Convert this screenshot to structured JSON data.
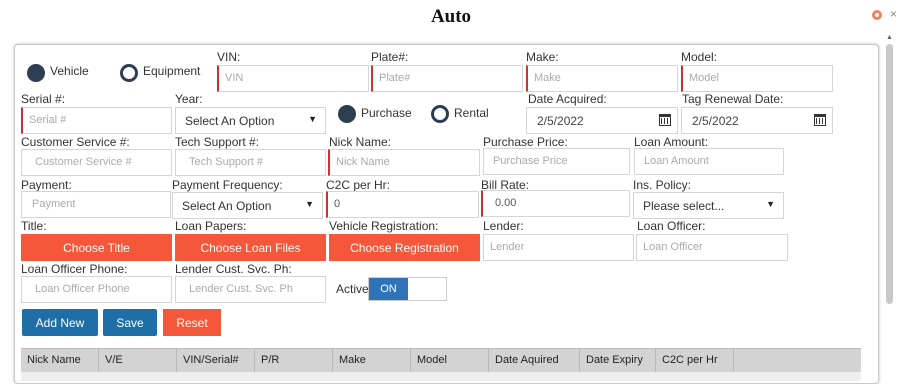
{
  "title": "Auto",
  "radios": {
    "vehicle": "Vehicle",
    "equipment": "Equipment",
    "purchase": "Purchase",
    "rental": "Rental"
  },
  "labels": {
    "vin": "VIN:",
    "plate": "Plate#:",
    "make": "Make:",
    "model": "Model:",
    "serial": "Serial #:",
    "year": "Year:",
    "date_acquired": "Date Acquired:",
    "tag_renewal": "Tag Renewal Date:",
    "customer_service": "Customer Service #:",
    "tech_support": "Tech Support #:",
    "nick_name": "Nick Name:",
    "purchase_price": "Purchase Price:",
    "loan_amount": "Loan Amount:",
    "payment": "Payment:",
    "payment_frequency": "Payment Frequency:",
    "c2c_per_hr": "C2C per Hr:",
    "bill_rate": "Bill Rate:",
    "ins_policy": "Ins. Policy:",
    "title_doc": "Title:",
    "loan_papers": "Loan Papers:",
    "vehicle_registration": "Vehicle Registration:",
    "lender": "Lender:",
    "loan_officer": "Loan Officer:",
    "loan_officer_phone": "Loan Officer Phone:",
    "lender_cust_svc": "Lender Cust. Svc. Ph:",
    "active": "Active"
  },
  "placeholders": {
    "vin": "VIN",
    "plate": "Plate#",
    "make": "Make",
    "model": "Model",
    "serial": "Serial #",
    "customer_service": "Customer Service #",
    "tech_support": "Tech Support #",
    "nick_name": "Nick Name",
    "purchase_price": "Purchase Price",
    "loan_amount": "Loan Amount",
    "payment": "Payment",
    "lender": "Lender",
    "loan_officer": "Loan Officer",
    "loan_officer_phone": "Loan Officer Phone",
    "lender_cust_svc": "Lender Cust. Svc. Ph"
  },
  "values": {
    "year": "Select An Option",
    "date_acquired": "2/5/2022",
    "tag_renewal": "2/5/2022",
    "payment_frequency": "Select An Option",
    "c2c_per_hr": "0",
    "bill_rate": "0.00",
    "ins_policy": "Please select..."
  },
  "buttons": {
    "choose_title": "Choose Title",
    "choose_loan_files": "Choose Loan Files",
    "choose_registration": "Choose Registration",
    "add_new": "Add New",
    "save": "Save",
    "reset": "Reset"
  },
  "toggle": {
    "on": "ON"
  },
  "table": {
    "columns": [
      "Nick Name",
      "V/E",
      "VIN/Serial#",
      "P/R",
      "Make",
      "Model",
      "Date Aquired",
      "Date Expiry",
      "C2C per Hr"
    ]
  },
  "colors": {
    "accent_red": "#f4573a",
    "accent_blue": "#1e6ea7",
    "required": "#d32f2f"
  }
}
